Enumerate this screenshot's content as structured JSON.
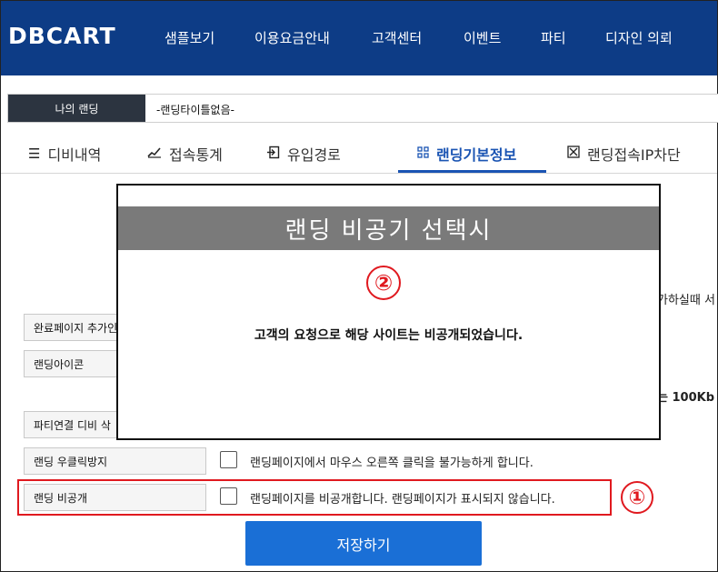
{
  "header": {
    "logo": "DBCART",
    "nav": [
      "샘플보기",
      "이용요금안내",
      "고객센터",
      "이벤트",
      "파티",
      "디자인 의뢰"
    ]
  },
  "landing": {
    "label": "나의 랜딩",
    "title": "-랜딩타이틀없음-"
  },
  "tabs": [
    {
      "label": "디비내역",
      "icon": "list-icon"
    },
    {
      "label": "접속통계",
      "icon": "chart-icon"
    },
    {
      "label": "유입경로",
      "icon": "enter-icon"
    },
    {
      "label": "랜딩기본정보",
      "icon": "grid-icon",
      "active": true
    },
    {
      "label": "랜딩접속IP차단",
      "icon": "block-icon"
    }
  ],
  "form": {
    "complete_page_label": "완료페이지 추가인",
    "landing_icon_label": "랜딩아이콘",
    "party_link_label": "파티연결 디비 삭",
    "right_click_label": "랜딩 우클릭방지",
    "right_click_text": "랜딩페이지에서 마우스 오른쪽 클릭을 불가능하게 합니다.",
    "private_label": "랜딩 비공개",
    "private_text": "랜딩페이지를 비공개합니다. 랜딩페이지가 표시되지 않습니다.",
    "partial_right_text_1": "가하실때 서",
    "partial_right_text_2": "는 100Kb"
  },
  "annotations": {
    "marker_1": "①",
    "marker_2": "②"
  },
  "modal": {
    "title": "랜딩 비공기 선택시",
    "message": "고객의 요청으로 해당 사이트는 비공개되었습니다."
  },
  "save_button": "저장하기",
  "colors": {
    "header_bg": "#0d3c86",
    "accent": "#1a54b3",
    "button": "#1a6fd6",
    "highlight": "#e0191f"
  }
}
